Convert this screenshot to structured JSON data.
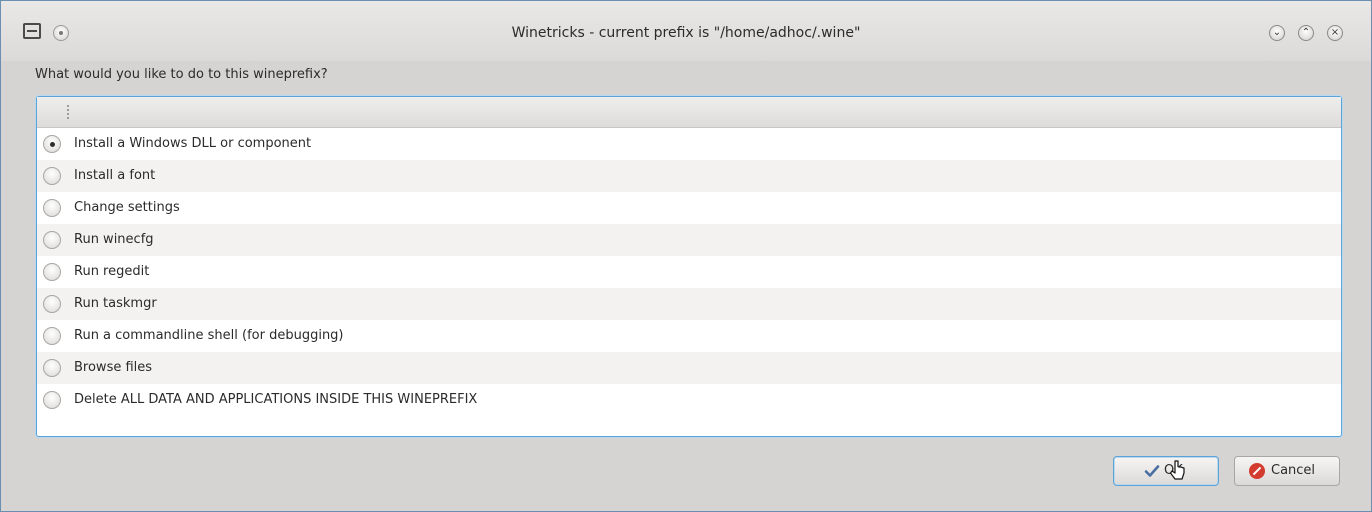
{
  "window": {
    "title": "Winetricks - current prefix is \"/home/adhoc/.wine\""
  },
  "prompt": {
    "question": "What would you like to do to this wineprefix?"
  },
  "options": [
    {
      "label": "Install a Windows DLL or component",
      "selected": true
    },
    {
      "label": "Install a font",
      "selected": false
    },
    {
      "label": "Change settings",
      "selected": false
    },
    {
      "label": "Run winecfg",
      "selected": false
    },
    {
      "label": "Run regedit",
      "selected": false
    },
    {
      "label": "Run taskmgr",
      "selected": false
    },
    {
      "label": "Run a commandline shell (for debugging)",
      "selected": false
    },
    {
      "label": "Browse files",
      "selected": false
    },
    {
      "label": "Delete ALL DATA AND APPLICATIONS INSIDE THIS WINEPREFIX",
      "selected": false
    }
  ],
  "buttons": {
    "ok_label": "OK",
    "cancel_label": "Cancel"
  },
  "icons": {
    "menu": "menu-icon",
    "ok": "checkmark-icon",
    "cancel": "cancel-icon"
  },
  "colors": {
    "focus_border": "#5ea3d6",
    "cancel_red": "#d33b2f"
  }
}
